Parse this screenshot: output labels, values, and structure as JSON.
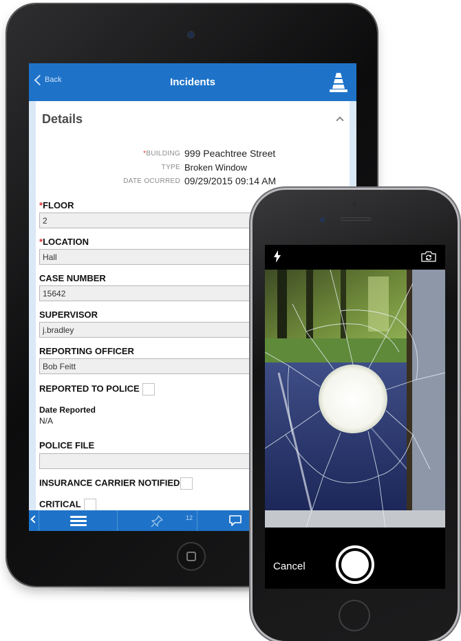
{
  "tablet": {
    "navbar": {
      "back_label": "Back",
      "title": "Incidents"
    },
    "details": {
      "section_title": "Details",
      "info": [
        {
          "label": "BUILDING",
          "required": true,
          "value": "999 Peachtree Street"
        },
        {
          "label": "TYPE",
          "required": false,
          "value": "Broken Window"
        },
        {
          "label": "DATE OCURRED",
          "required": false,
          "value": "09/29/2015 09:14 AM"
        }
      ],
      "fields": [
        {
          "label": "FLOOR",
          "required": true,
          "value": "2"
        },
        {
          "label": "LOCATION",
          "required": true,
          "value": "Hall"
        },
        {
          "label": "CASE NUMBER",
          "required": false,
          "value": "15642"
        },
        {
          "label": "SUPERVISOR",
          "required": false,
          "value": "j.bradley"
        },
        {
          "label": "REPORTING OFFICER",
          "required": false,
          "value": "Bob Feitt"
        }
      ],
      "reported_to_police": {
        "label": "REPORTED TO POLICE",
        "checked": false
      },
      "date_reported": {
        "label": "Date Reported",
        "value": "N/A"
      },
      "police_file": {
        "label": "POLICE FILE",
        "value": ""
      },
      "insurance_carrier_notified": {
        "label": "INSURANCE CARRIER NOTIFIED",
        "checked": false
      },
      "critical": {
        "label": "CRITICAL",
        "checked": false
      }
    },
    "toolbar": {
      "pin_count": "12"
    },
    "colors": {
      "accent": "#1e73c9",
      "required": "#d9302c"
    }
  },
  "phone": {
    "camera": {
      "cancel_label": "Cancel",
      "flash": "flash-icon",
      "flip": "flip-camera-icon"
    }
  }
}
